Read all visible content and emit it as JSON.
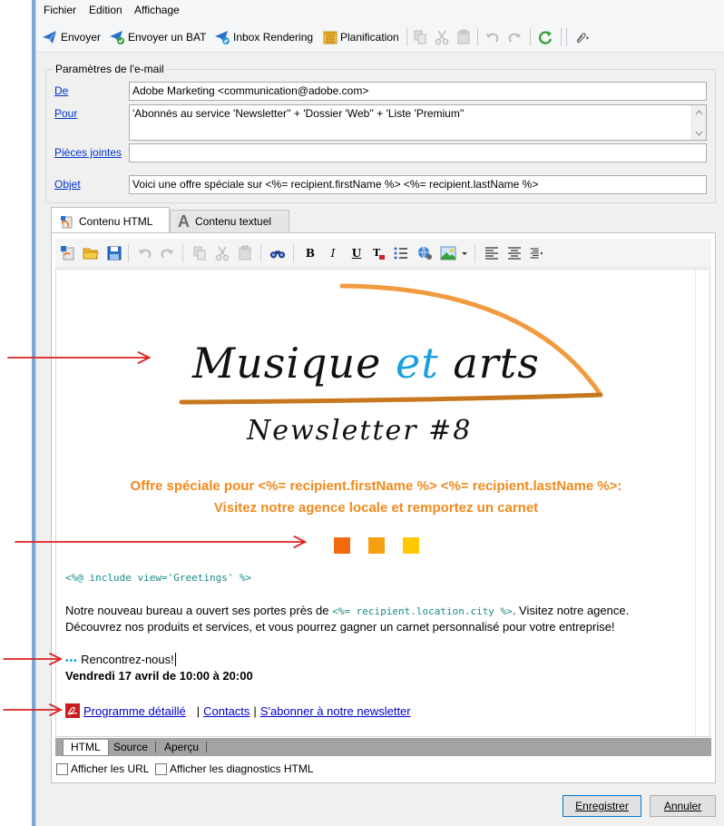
{
  "menu": [
    "Fichier",
    "Edition",
    "Affichage"
  ],
  "toolbar": {
    "send": "Envoyer",
    "send_bat": "Envoyer un BAT",
    "inbox_rendering": "Inbox Rendering",
    "schedule": "Planification"
  },
  "params": {
    "group_title": "Paramètres de l'e-mail",
    "from_label": "De",
    "from_value": "Adobe Marketing  <communication@adobe.com>",
    "to_label": "Pour",
    "to_value": "'Abonnés au service 'Newsletter'' + 'Dossier 'Web'' + 'Liste 'Premium''",
    "attachments_label": "Pièces jointes",
    "attachments_value": "",
    "subject_label": "Objet",
    "subject_value": "Voici une offre spéciale sur <%= recipient.firstName %> <%= recipient.lastName %>"
  },
  "tabs": {
    "html": "Contenu HTML",
    "text": "Contenu textuel"
  },
  "email": {
    "logo_part1": "Musique",
    "logo_part2": "et",
    "logo_part3": "arts",
    "newsletter_title": "Newsletter #8",
    "offer_line1": "Offre spéciale pour <%= recipient.firstName %> <%= recipient.lastName %>:",
    "offer_line2": "Visitez notre agence locale et remportez un carnet",
    "square_colors": [
      "#f26a10",
      "#f5a010",
      "#ffc800"
    ],
    "include_tag": "<%@ include view='Greetings' %>",
    "body_line1_a": "Notre nouveau bureau a ouvert ses portes près de ",
    "body_line1_code": "<%= recipient.location.city %>",
    "body_line1_b": ". Visitez notre agence.",
    "body_line2": "Découvrez nos produits et services, et vous pourrez gagner un carnet personnalisé pour votre entreprise!",
    "dots": "•••",
    "meet": "Rencontrez-nous!",
    "date": "Vendredi 17 avril  de 10:00 à 20:00",
    "link_program": "Programme détaillé",
    "link_sep": "|",
    "link_contacts": "Contacts",
    "link_subscribe": "S'abonner à notre newsletter",
    "accent_orange": "#f08a1c",
    "accent_blue": "#1aa0e0"
  },
  "view_tabs": [
    "HTML",
    "Source",
    "Aperçu"
  ],
  "options": {
    "show_urls": "Afficher les URL",
    "show_diag": "Afficher les diagnostics HTML"
  },
  "buttons": {
    "save": "Enregistrer",
    "cancel": "Annuler"
  }
}
